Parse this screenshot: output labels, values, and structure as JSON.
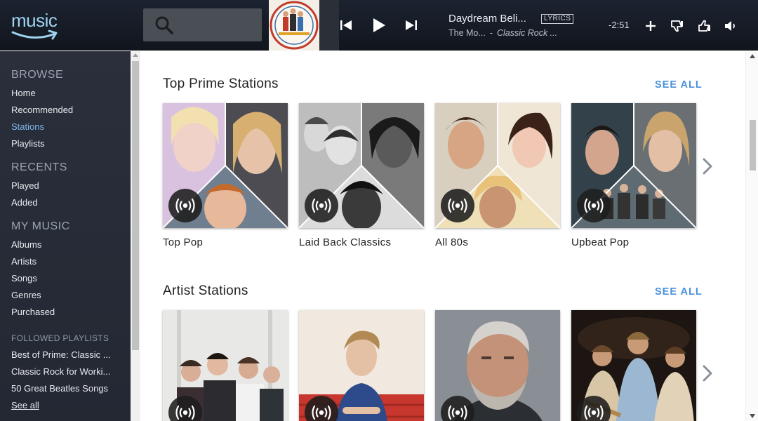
{
  "app": {
    "logo_text": "music",
    "brand_color": "#9fd3f2",
    "accent_color": "#4a90d9"
  },
  "search": {
    "placeholder": ""
  },
  "player": {
    "title": "Daydream Beli...",
    "lyrics_label": "LYRICS",
    "artist": "The Mo...",
    "separator": "-",
    "station": "Classic Rock ...",
    "time_remaining": "-2:51",
    "icons": [
      "previous-icon",
      "play-icon",
      "next-icon",
      "add-icon",
      "thumbs-down-icon",
      "thumbs-up-icon",
      "volume-icon"
    ]
  },
  "sidebar": {
    "browse_heading": "BROWSE",
    "browse": [
      "Home",
      "Recommended",
      "Stations",
      "Playlists"
    ],
    "active_item": "Stations",
    "recents_heading": "RECENTS",
    "recents": [
      "Played",
      "Added"
    ],
    "mymusic_heading": "MY MUSIC",
    "mymusic": [
      "Albums",
      "Artists",
      "Songs",
      "Genres",
      "Purchased"
    ],
    "followed_heading": "FOLLOWED PLAYLISTS",
    "followed": [
      "Best of Prime: Classic ...",
      "Classic Rock for Worki...",
      "50 Great Beatles Songs"
    ],
    "see_all": "See all"
  },
  "sections": [
    {
      "title": "Top Prime Stations",
      "see_all": "SEE ALL",
      "cards": [
        {
          "label": "Top Pop"
        },
        {
          "label": "Laid Back Classics"
        },
        {
          "label": "All 80s"
        },
        {
          "label": "Upbeat Pop"
        }
      ]
    },
    {
      "title": "Artist Stations",
      "see_all": "SEE ALL",
      "cards": [
        {
          "label": ""
        },
        {
          "label": ""
        },
        {
          "label": ""
        },
        {
          "label": ""
        }
      ]
    }
  ]
}
